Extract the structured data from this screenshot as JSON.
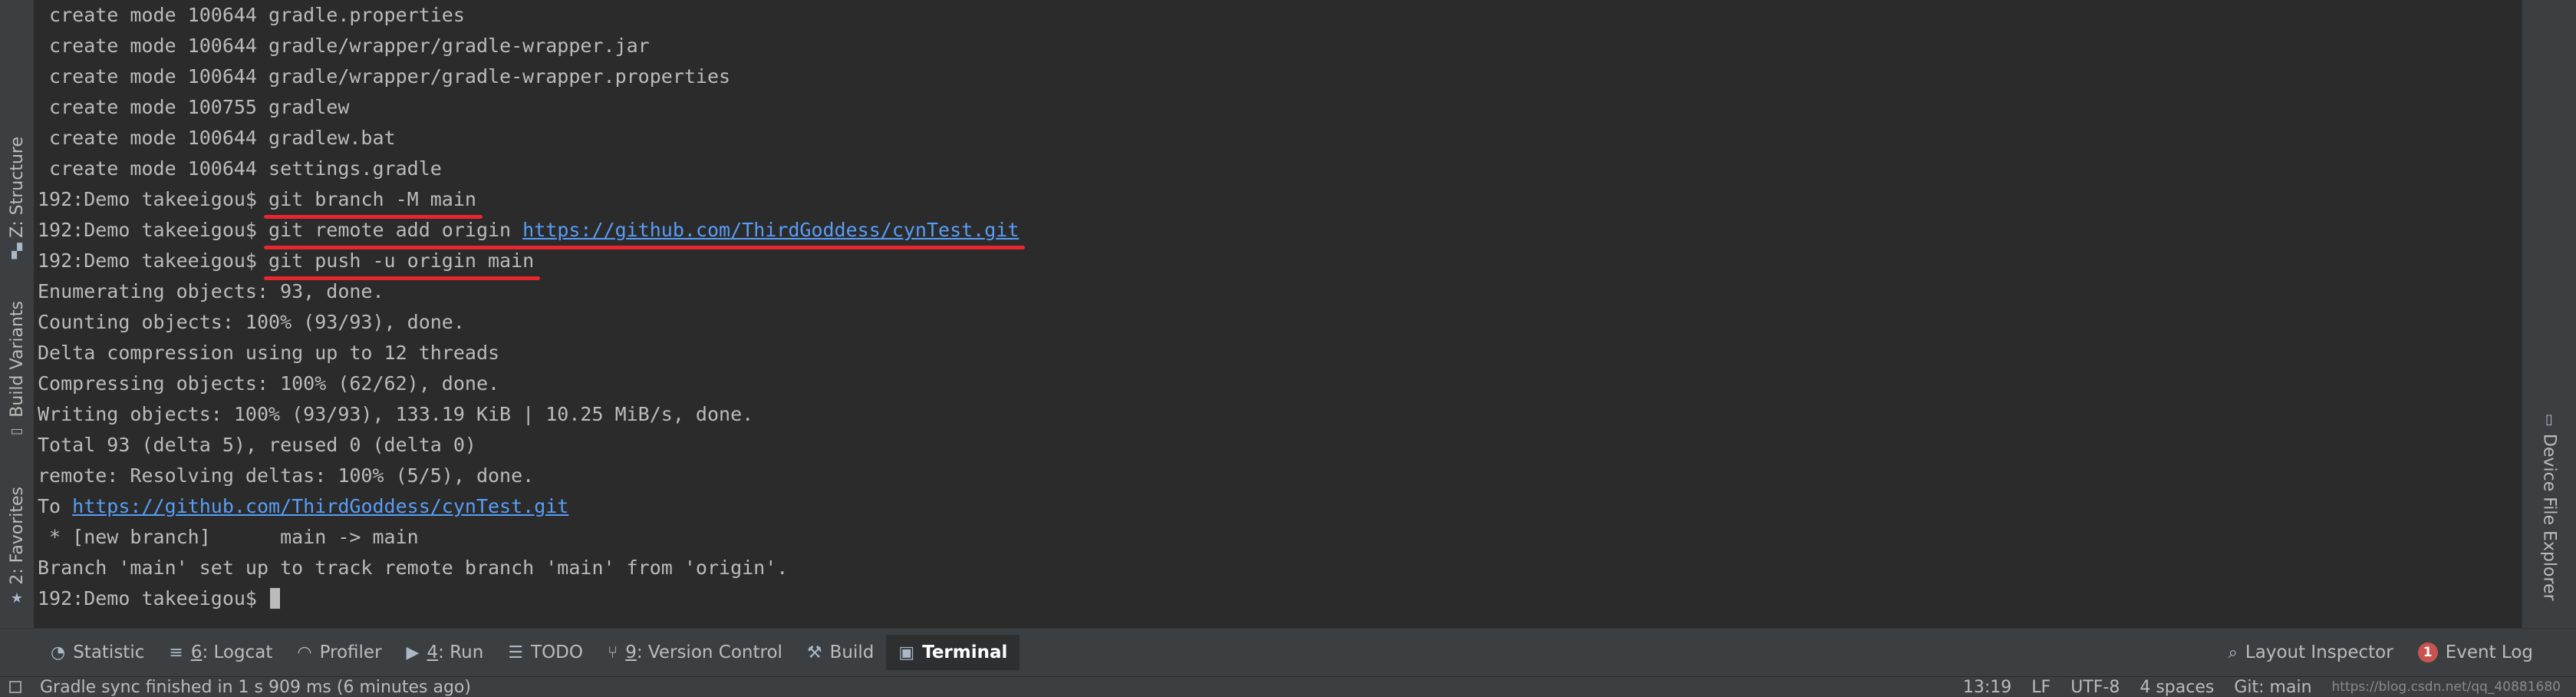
{
  "terminal": {
    "lines": [
      {
        "prompt": "",
        "text": " create mode 100644 gradle.properties"
      },
      {
        "prompt": "",
        "text": " create mode 100644 gradle/wrapper/gradle-wrapper.jar"
      },
      {
        "prompt": "",
        "text": " create mode 100644 gradle/wrapper/gradle-wrapper.properties"
      },
      {
        "prompt": "",
        "text": " create mode 100755 gradlew"
      },
      {
        "prompt": "",
        "text": " create mode 100644 gradlew.bat"
      },
      {
        "prompt": "",
        "text": " create mode 100644 settings.gradle"
      },
      {
        "prompt": "192:Demo takeeigou$ ",
        "command": "git branch -M main"
      },
      {
        "prompt": "192:Demo takeeigou$ ",
        "command": "git remote add origin ",
        "link": "https://github.com/ThirdGoddess/cynTest.git"
      },
      {
        "prompt": "192:Demo takeeigou$ ",
        "command": "git push -u origin main"
      },
      {
        "prompt": "",
        "text": "Enumerating objects: 93, done."
      },
      {
        "prompt": "",
        "text": "Counting objects: 100% (93/93), done."
      },
      {
        "prompt": "",
        "text": "Delta compression using up to 12 threads"
      },
      {
        "prompt": "",
        "text": "Compressing objects: 100% (62/62), done."
      },
      {
        "prompt": "",
        "text": "Writing objects: 100% (93/93), 133.19 KiB | 10.25 MiB/s, done."
      },
      {
        "prompt": "",
        "text": "Total 93 (delta 5), reused 0 (delta 0)"
      },
      {
        "prompt": "",
        "text": "remote: Resolving deltas: 100% (5/5), done."
      },
      {
        "prompt": "To ",
        "link": "https://github.com/ThirdGoddess/cynTest.git"
      },
      {
        "prompt": "",
        "text": " * [new branch]      main -> main"
      },
      {
        "prompt": "",
        "text": "Branch 'main' set up to track remote branch 'main' from 'origin'."
      },
      {
        "prompt": "192:Demo takeeigou$ ",
        "cursor": true
      }
    ]
  },
  "left_tabs": {
    "structure": {
      "label": "Z: Structure",
      "icon": "structure-icon"
    },
    "build_variants": {
      "label": "Build Variants",
      "icon": "android-icon"
    },
    "favorites": {
      "label": "2: Favorites",
      "icon": "star-icon"
    }
  },
  "right_tabs": {
    "device_file_explorer": {
      "label": "Device File Explorer",
      "icon": "device-icon"
    }
  },
  "toolbar": {
    "statistic": {
      "label": "Statistic",
      "icon": "statistic-icon"
    },
    "logcat": {
      "mnemonic": "6",
      "label": ": Logcat",
      "icon": "logcat-icon"
    },
    "profiler": {
      "label": "Profiler",
      "icon": "profiler-icon"
    },
    "run": {
      "mnemonic": "4",
      "label": ": Run",
      "icon": "run-icon"
    },
    "todo": {
      "label": "TODO",
      "icon": "list-icon"
    },
    "version_control": {
      "mnemonic": "9",
      "label": ": Version Control",
      "icon": "branch-icon"
    },
    "build": {
      "label": "Build",
      "icon": "hammer-icon"
    },
    "terminal": {
      "label": "Terminal",
      "icon": "terminal-icon"
    },
    "layout_inspector": {
      "label": "Layout Inspector",
      "icon": "inspector-icon"
    },
    "event_log": {
      "label": "Event Log",
      "badge": "1"
    }
  },
  "status": {
    "message": "Gradle sync finished in 1 s 909 ms (6 minutes ago)",
    "position": "13:19",
    "line_sep": "LF",
    "encoding": "UTF-8",
    "indent": "4 spaces",
    "branch": "Git: main",
    "watermark": "https://blog.csdn.net/qq_40881680"
  },
  "colors": {
    "accent_underline": "#e8262f",
    "link": "#589df6",
    "badge": "#c75450"
  }
}
